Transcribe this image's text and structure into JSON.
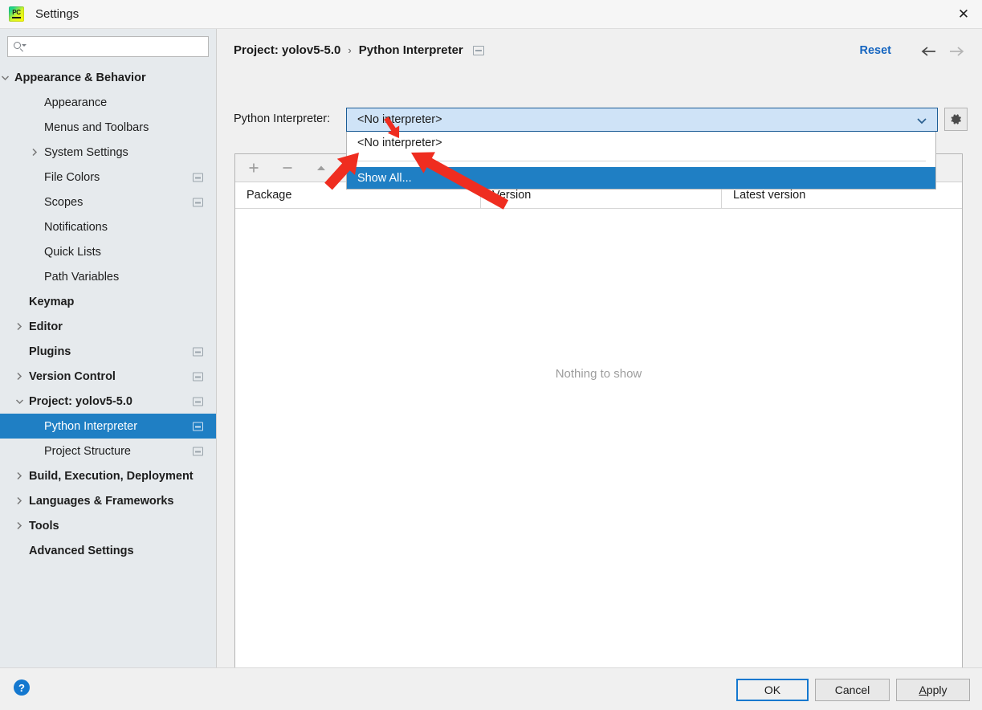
{
  "window": {
    "title": "Settings",
    "app_icon": "pycharm-logo-icon",
    "close_icon": "close-icon"
  },
  "sidebar": {
    "search": {
      "value": "",
      "placeholder": "",
      "icon": "search-icon"
    },
    "items": [
      {
        "label": "Appearance & Behavior",
        "indent": 18,
        "bold": true,
        "chevron": "down",
        "badge": false,
        "selected": false
      },
      {
        "label": "Appearance",
        "indent": 55,
        "bold": false,
        "chevron": "none",
        "badge": false,
        "selected": false
      },
      {
        "label": "Menus and Toolbars",
        "indent": 55,
        "bold": false,
        "chevron": "none",
        "badge": false,
        "selected": false
      },
      {
        "label": "System Settings",
        "indent": 55,
        "bold": false,
        "chevron": "right",
        "badge": false,
        "selected": false
      },
      {
        "label": "File Colors",
        "indent": 55,
        "bold": false,
        "chevron": "none",
        "badge": true,
        "selected": false
      },
      {
        "label": "Scopes",
        "indent": 55,
        "bold": false,
        "chevron": "none",
        "badge": true,
        "selected": false
      },
      {
        "label": "Notifications",
        "indent": 55,
        "bold": false,
        "chevron": "none",
        "badge": false,
        "selected": false
      },
      {
        "label": "Quick Lists",
        "indent": 55,
        "bold": false,
        "chevron": "none",
        "badge": false,
        "selected": false
      },
      {
        "label": "Path Variables",
        "indent": 55,
        "bold": false,
        "chevron": "none",
        "badge": false,
        "selected": false
      },
      {
        "label": "Keymap",
        "indent": 36,
        "bold": true,
        "chevron": "none",
        "badge": false,
        "selected": false
      },
      {
        "label": "Editor",
        "indent": 36,
        "bold": true,
        "chevron": "right",
        "badge": false,
        "selected": false
      },
      {
        "label": "Plugins",
        "indent": 36,
        "bold": true,
        "chevron": "none",
        "badge": true,
        "selected": false
      },
      {
        "label": "Version Control",
        "indent": 36,
        "bold": true,
        "chevron": "right",
        "badge": true,
        "selected": false
      },
      {
        "label": "Project: yolov5-5.0",
        "indent": 36,
        "bold": true,
        "chevron": "down",
        "badge": true,
        "selected": false
      },
      {
        "label": "Python Interpreter",
        "indent": 55,
        "bold": false,
        "chevron": "none",
        "badge": true,
        "selected": true
      },
      {
        "label": "Project Structure",
        "indent": 55,
        "bold": false,
        "chevron": "none",
        "badge": true,
        "selected": false
      },
      {
        "label": "Build, Execution, Deployment",
        "indent": 36,
        "bold": true,
        "chevron": "right",
        "badge": false,
        "selected": false
      },
      {
        "label": "Languages & Frameworks",
        "indent": 36,
        "bold": true,
        "chevron": "right",
        "badge": false,
        "selected": false
      },
      {
        "label": "Tools",
        "indent": 36,
        "bold": true,
        "chevron": "right",
        "badge": false,
        "selected": false
      },
      {
        "label": "Advanced Settings",
        "indent": 36,
        "bold": true,
        "chevron": "none",
        "badge": false,
        "selected": false
      }
    ]
  },
  "content": {
    "breadcrumb": {
      "root": "Project: yolov5-5.0",
      "separator": "›",
      "leaf": "Python Interpreter"
    },
    "reset_label": "Reset",
    "nav_back_icon": "arrow-left-icon",
    "nav_forward_icon": "arrow-right-icon",
    "interpreter_label": "Python Interpreter:",
    "interpreter_value": "<No interpreter>",
    "gear_icon": "gear-icon",
    "dropdown": {
      "open": true,
      "options": [
        "<No interpreter>"
      ],
      "action_item": "Show All...",
      "highlighted": "Show All..."
    },
    "packages": {
      "toolbar_icons": [
        "add-icon",
        "remove-icon",
        "upgrade-icon",
        "eye-icon"
      ],
      "columns": [
        "Package",
        "Version",
        "Latest version"
      ],
      "rows": [],
      "empty_text": "Nothing to show"
    }
  },
  "footer": {
    "help_icon": "help-icon",
    "help_label": "?",
    "buttons": [
      {
        "label": "OK",
        "primary": true
      },
      {
        "label": "Cancel",
        "primary": false
      },
      {
        "label": "Apply",
        "primary": false
      }
    ]
  },
  "annotations": {
    "arrow_color": "#ef2d20",
    "count": 3
  }
}
